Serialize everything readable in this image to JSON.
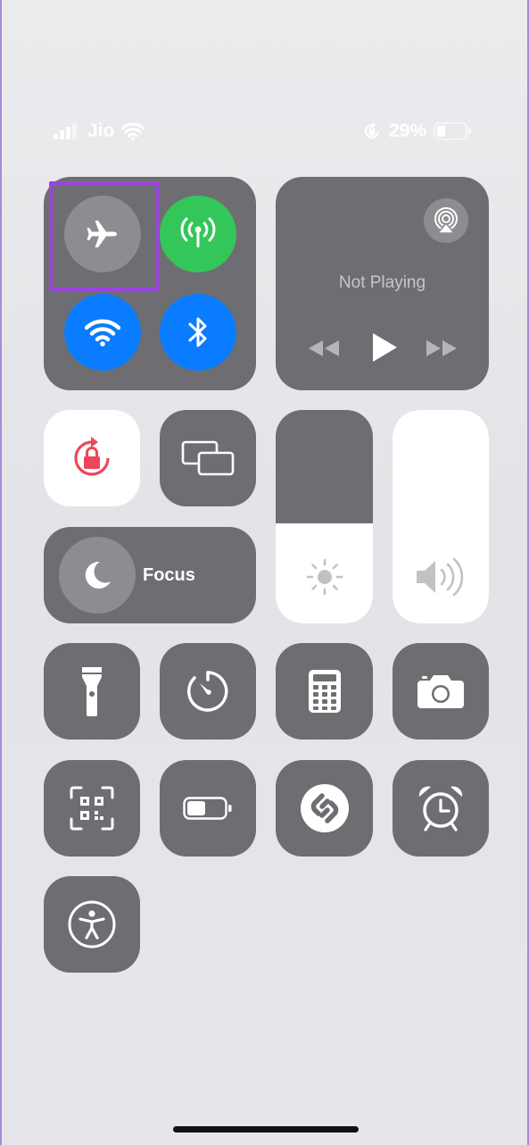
{
  "status_bar": {
    "carrier": "Jio",
    "battery_percent": "29%",
    "battery_level": 0.29,
    "icons": [
      "signal-bars-icon",
      "wifi-icon",
      "orientation-lock-icon",
      "battery-icon"
    ]
  },
  "connectivity": {
    "airplane_mode": "off",
    "cellular_data": "on",
    "wifi": "on",
    "bluetooth": "on",
    "highlight_color": "#9b45e0"
  },
  "media": {
    "status": "Not Playing",
    "controls": [
      "airplay-icon",
      "rewind-icon",
      "play-icon",
      "fast-forward-icon"
    ]
  },
  "focus": {
    "label": "Focus"
  },
  "sliders": {
    "brightness_level": 0.47,
    "volume_level": 1.0
  },
  "colors": {
    "tile_dark": "#6e6e72",
    "tile_white": "#ffffff",
    "green": "#33c759",
    "blue": "#0a7cff",
    "lock_red": "#ee4659"
  },
  "controls": [
    "flashlight-icon",
    "timer-icon",
    "calculator-icon",
    "camera-icon",
    "qr-code-scanner-icon",
    "low-power-mode-icon",
    "shazam-icon",
    "alarm-icon",
    "accessibility-icon"
  ]
}
